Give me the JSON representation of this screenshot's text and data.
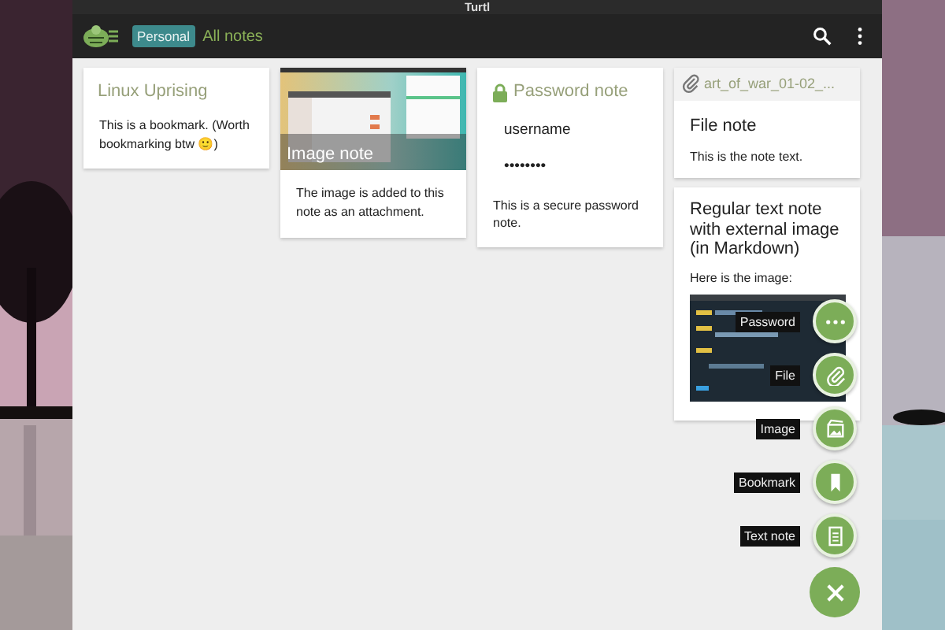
{
  "window": {
    "title": "Turtl"
  },
  "header": {
    "space": "Personal",
    "board": "All notes"
  },
  "columns": [
    {
      "notes": [
        {
          "kind": "bookmark",
          "title": "Linux Uprising",
          "text": "This is a bookmark. (Worth bookmarking btw 🙂)"
        }
      ]
    },
    {
      "notes": [
        {
          "title": "Image note",
          "text": "The image is added to this note as an attachment."
        }
      ]
    },
    {
      "notes": [
        {
          "kind": "password",
          "title": "Password note",
          "username": "username",
          "password": "••••••••",
          "text": "This is a secure password note."
        }
      ]
    },
    {
      "notes": [
        {
          "kind": "file",
          "filename": "art_of_war_01-02_...",
          "title": "File note",
          "text": "This is the note text."
        },
        {
          "kind": "text",
          "title": "Regular text note with external image (in Markdown)",
          "text": "Here is the image:"
        }
      ]
    }
  ],
  "add_menu": {
    "items": [
      {
        "kind": "password",
        "label": "Password"
      },
      {
        "kind": "file",
        "label": "File"
      },
      {
        "label": "Image"
      },
      {
        "kind": "bookmark",
        "label": "Bookmark"
      },
      {
        "kind": "text",
        "label": "Text note"
      }
    ]
  }
}
